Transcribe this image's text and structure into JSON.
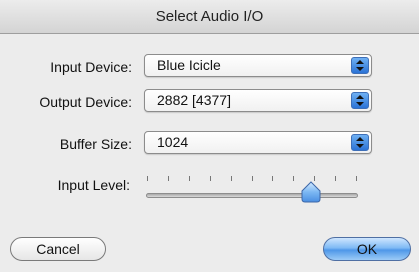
{
  "window": {
    "title": "Select Audio I/O"
  },
  "fields": {
    "input_device": {
      "label": "Input Device:",
      "value": "Blue Icicle"
    },
    "output_device": {
      "label": "Output Device:",
      "value": "2882 [4377]"
    },
    "buffer_size": {
      "label": "Buffer Size:",
      "value": "1024"
    },
    "input_level": {
      "label": "Input Level:",
      "level": 0.78
    }
  },
  "buttons": {
    "cancel": "Cancel",
    "ok": "OK"
  },
  "colors": {
    "accent": "#4e97e8",
    "window_bg": "#ececec"
  },
  "icons": {
    "popup_arrows": "up-down-arrows-icon",
    "slider_thumb": "slider-thumb-icon"
  }
}
